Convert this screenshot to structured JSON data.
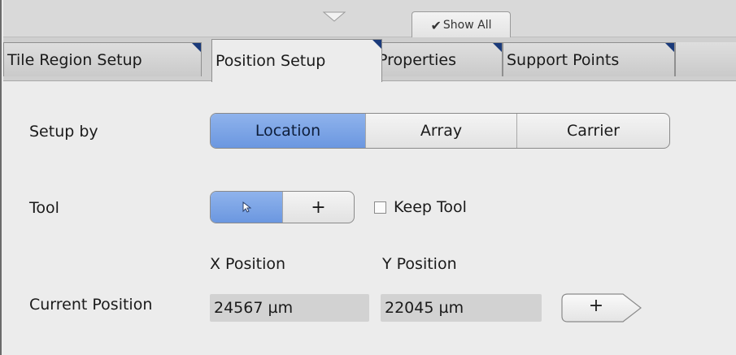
{
  "top_strip": {
    "collapse_icon": "chevron-down-icon",
    "show_all_label": "Show All",
    "show_all_checked": true
  },
  "tabs": [
    {
      "label": "Tile Region Setup",
      "active": false
    },
    {
      "label": "Position Setup",
      "active": true
    },
    {
      "label": "Properties",
      "active": false
    },
    {
      "label": "Support Points",
      "active": false
    }
  ],
  "setup_by": {
    "label": "Setup by",
    "options": [
      "Location",
      "Array",
      "Carrier"
    ],
    "selected": "Location"
  },
  "tool": {
    "label": "Tool",
    "options": [
      {
        "icon": "pointer-arrow-icon",
        "selected": true
      },
      {
        "icon": "plus-icon",
        "text": "+",
        "selected": false
      }
    ],
    "keep_tool_label": "Keep Tool",
    "keep_tool_checked": false
  },
  "current_position": {
    "label": "Current Position",
    "x_header": "X Position",
    "y_header": "Y Position",
    "x_value": "24567 µm",
    "y_value": "22045 µm",
    "add_button_text": "+"
  },
  "colors": {
    "selected_segment": "#7aa3e6",
    "field_bg": "#d2d2d2",
    "tab_corner": "#1a3a7a"
  }
}
